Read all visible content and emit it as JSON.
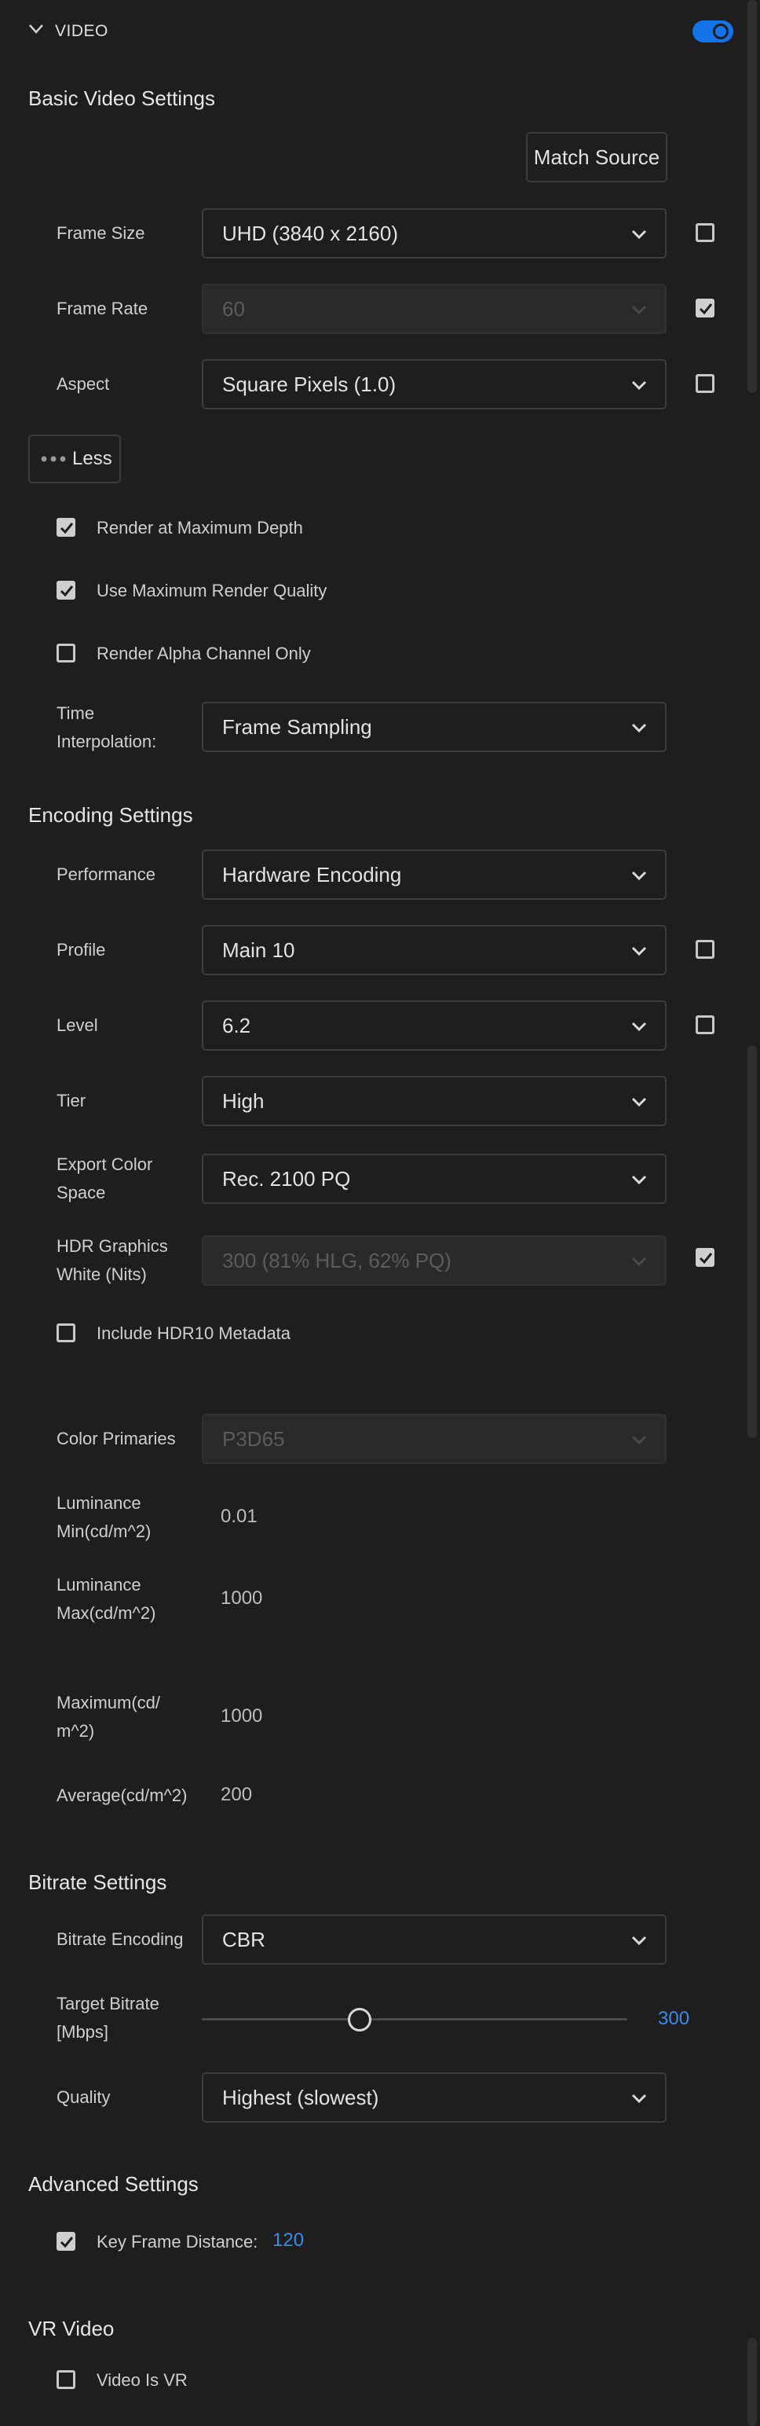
{
  "header": {
    "title": "VIDEO",
    "toggle_on": true,
    "accent": "#1473e6"
  },
  "basic": {
    "title": "Basic Video Settings",
    "match_source": "Match Source",
    "frame_size": {
      "label": "Frame Size",
      "value": "UHD (3840 x 2160)"
    },
    "frame_rate": {
      "label": "Frame Rate",
      "value": "60"
    },
    "aspect": {
      "label": "Aspect",
      "value": "Square Pixels (1.0)"
    },
    "less": "Less",
    "render_max_depth": "Render at Maximum Depth",
    "max_render_quality": "Use Maximum Render Quality",
    "alpha_only": "Render Alpha Channel Only",
    "time_interp": {
      "label_1": "Time",
      "label_2": "Interpolation:",
      "value": "Frame Sampling"
    }
  },
  "encoding": {
    "title": "Encoding Settings",
    "performance": {
      "label": "Performance",
      "value": "Hardware Encoding"
    },
    "profile": {
      "label": "Profile",
      "value": "Main 10"
    },
    "level": {
      "label": "Level",
      "value": "6.2"
    },
    "tier": {
      "label": "Tier",
      "value": "High"
    },
    "color_space": {
      "label_1": "Export Color",
      "label_2": "Space",
      "value": "Rec. 2100 PQ"
    },
    "hdr_white": {
      "label_1": "HDR Graphics",
      "label_2": "White (Nits)",
      "value": "300 (81% HLG, 62% PQ)"
    },
    "hdr10": "Include HDR10 Metadata",
    "color_primaries": {
      "label": "Color Primaries",
      "value": "P3D65"
    },
    "lum_min": {
      "label_1": "Luminance",
      "label_2": "Min(cd/m^2)",
      "value": "0.01"
    },
    "lum_max": {
      "label_1": "Luminance",
      "label_2": "Max(cd/m^2)",
      "value": "1000"
    },
    "maximum": {
      "label_1": "Maximum(cd/",
      "label_2": "m^2)",
      "value": "1000"
    },
    "average": {
      "label": "Average(cd/m^2)",
      "value": "200"
    }
  },
  "bitrate": {
    "title": "Bitrate Settings",
    "encoding": {
      "label": "Bitrate Encoding",
      "value": "CBR"
    },
    "target": {
      "label_1": "Target Bitrate",
      "label_2": "[Mbps]",
      "value": "300",
      "fraction": 0.37
    },
    "quality": {
      "label": "Quality",
      "value": "Highest (slowest)"
    }
  },
  "advanced": {
    "title": "Advanced Settings",
    "key_frame": {
      "label": "Key Frame Distance:",
      "value": "120"
    }
  },
  "vr": {
    "title": "VR Video",
    "is_vr": "Video Is VR"
  }
}
